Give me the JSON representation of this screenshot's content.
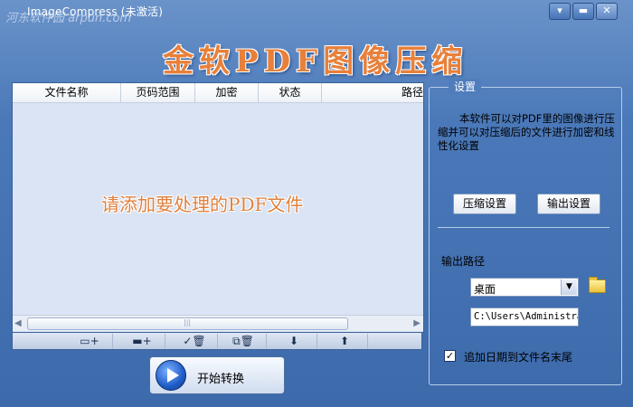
{
  "window": {
    "title": "ImageCompress (未激活)",
    "watermark": "河东软件园 arpun.com",
    "minimize_glyph": "▾",
    "maximize_glyph": "▬",
    "close_glyph": "✕"
  },
  "banner": {
    "text": "金软PDF图像压缩"
  },
  "file_list": {
    "columns": [
      "文件名称",
      "页码范围",
      "加密",
      "状态",
      "路径"
    ],
    "empty_message": "请添加要处理的PDF文件"
  },
  "scrollbar": {
    "left_glyph": "◀",
    "right_glyph": "▶",
    "grip_glyph": "|||"
  },
  "toolbar": {
    "buttons": [
      {
        "name": "add-file-icon",
        "glyph": "▭+"
      },
      {
        "name": "add-folder-icon",
        "glyph": "▬+"
      },
      {
        "name": "remove-checked-icon",
        "glyph": "✓🗑"
      },
      {
        "name": "remove-all-icon",
        "glyph": "⧉🗑"
      },
      {
        "name": "move-down-icon",
        "glyph": "⬇"
      },
      {
        "name": "move-up-icon",
        "glyph": "⬆"
      }
    ]
  },
  "start_button": {
    "label": "开始转换"
  },
  "settings": {
    "title": "设置",
    "description": "本软件可以对PDF里的图像进行压缩并可以对压缩后的文件进行加密和线性化设置",
    "compress_button": "压缩设置",
    "output_button": "输出设置",
    "output_path_label": "输出路径",
    "output_dropdown_value": "桌面",
    "output_path_value": "C:\\Users\\Administra",
    "append_date_label": "追加日期到文件名末尾",
    "append_date_checked": true
  }
}
